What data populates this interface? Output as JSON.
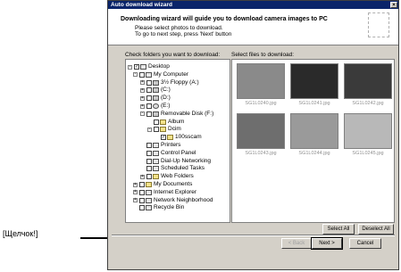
{
  "callout": "[Щелчок!]",
  "window": {
    "title": "Auto download wizard",
    "close": "×"
  },
  "header": {
    "heading": "Downloading wizard will guide you to download camera images to PC",
    "line1": "Please select photos to download.",
    "line2": "To go to next step, press 'Next' button"
  },
  "left_label": "Check folders you want to download:",
  "right_label": "Select files to download:",
  "tree": [
    {
      "label": "Desktop",
      "pm": "-",
      "icon": "desktop-icon",
      "iclass": "",
      "checked": "✓"
    },
    {
      "label": "My Computer",
      "pm": "-",
      "icon": "computer-icon",
      "iclass": "",
      "checked": ""
    },
    {
      "label": "3½ Floppy (A:)",
      "pm": "+",
      "icon": "floppy-icon",
      "iclass": "drive",
      "checked": ""
    },
    {
      "label": "(C:)",
      "pm": "+",
      "icon": "drive-icon",
      "iclass": "drive",
      "checked": ""
    },
    {
      "label": "(D:)",
      "pm": "+",
      "icon": "drive-icon",
      "iclass": "drive",
      "checked": ""
    },
    {
      "label": "(E:)",
      "pm": "+",
      "icon": "cd-icon",
      "iclass": "cd",
      "checked": ""
    },
    {
      "label": "Removable Disk (F:)",
      "pm": "-",
      "icon": "removable-disk-icon",
      "iclass": "drive",
      "checked": ""
    },
    {
      "label": "Album",
      "pm": "",
      "icon": "folder-icon",
      "iclass": "folder",
      "checked": ""
    },
    {
      "label": "Dcim",
      "pm": "-",
      "icon": "folder-icon",
      "iclass": "folder",
      "checked": ""
    },
    {
      "label": "100sscam",
      "pm": "",
      "icon": "folder-icon",
      "iclass": "folder",
      "checked": "✓"
    },
    {
      "label": "Printers",
      "pm": "",
      "icon": "printers-icon",
      "iclass": "",
      "checked": ""
    },
    {
      "label": "Control Panel",
      "pm": "",
      "icon": "control-panel-icon",
      "iclass": "",
      "checked": ""
    },
    {
      "label": "Dial-Up Networking",
      "pm": "",
      "icon": "dialup-icon",
      "iclass": "",
      "checked": ""
    },
    {
      "label": "Scheduled Tasks",
      "pm": "",
      "icon": "tasks-icon",
      "iclass": "",
      "checked": ""
    },
    {
      "label": "Web Folders",
      "pm": "+",
      "icon": "web-folders-icon",
      "iclass": "folder",
      "checked": ""
    },
    {
      "label": "My Documents",
      "pm": "+",
      "icon": "documents-icon",
      "iclass": "folder",
      "checked": ""
    },
    {
      "label": "Internet Explorer",
      "pm": "+",
      "icon": "ie-icon",
      "iclass": "",
      "checked": ""
    },
    {
      "label": "Network Neighborhood",
      "pm": "+",
      "icon": "network-icon",
      "iclass": "",
      "checked": ""
    },
    {
      "label": "Recycle Bin",
      "pm": "",
      "icon": "recycle-bin-icon",
      "iclass": "",
      "checked": ""
    }
  ],
  "thumbnails": [
    {
      "caption": "SG1L0240.jpg",
      "color": "#8a8a8a"
    },
    {
      "caption": "SG1L0241.jpg",
      "color": "#2a2a2a"
    },
    {
      "caption": "SG1L0242.jpg",
      "color": "#3a3a3a"
    },
    {
      "caption": "SG1L0243.jpg",
      "color": "#6e6e6e"
    },
    {
      "caption": "SG1L0244.jpg",
      "color": "#9a9a9a"
    },
    {
      "caption": "SG1L0245.jpg",
      "color": "#b8b8b8"
    }
  ],
  "buttons": {
    "select_all": "Select All",
    "deselect_all": "Deselect All",
    "back": "< Back",
    "next": "Next >",
    "cancel": "Cancel"
  }
}
